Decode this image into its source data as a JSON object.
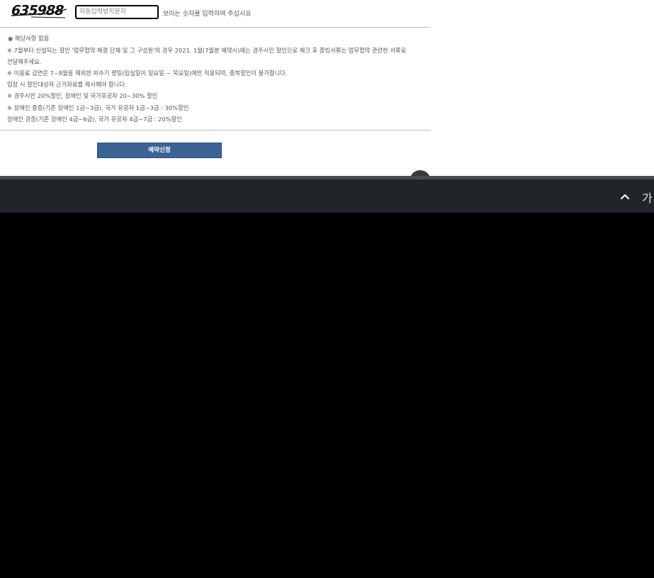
{
  "captcha": {
    "code": "635988",
    "input_placeholder": "자동입력방지문자",
    "hint": "보이는 숫자를 입력하여 주십시요"
  },
  "notes": [
    "◉  해당사항 없음",
    "※ 7월부터 신설되는 할인 '업무협약 체결 단체 및 그 구성원'의 경우 2021. 1월(7월분 예약시)에는 경주시민 할인으로 체크 후 증빙서류는 업무협약 관련한 서류로",
    "전달해주세요.",
    "※ 이용료 감면은 7~8월을 제외한 비수기 평일(입실일이 일요일 ~ 목요일)에만 적용되며, 중복할인이 불가합니다.",
    "     입장 시 할인대상자 근거자료를 제시해야 합니다.",
    "※ 경주시민 20%할인, 장애인 및 국가유공자 20~30% 할인",
    "※ 장애인 중증(기존 장애인 1급~3급), 국가 유공자 1급~3급 : 30%할인",
    "     장애인 경증(기존 장애인 4급~6급), 국가 유공자 4급~7급 : 20%할인"
  ],
  "reserve_button": "예약신청",
  "bottom_bar": {
    "text": "가"
  },
  "colors": {
    "button": "#3c6396",
    "bar": "#212529"
  }
}
